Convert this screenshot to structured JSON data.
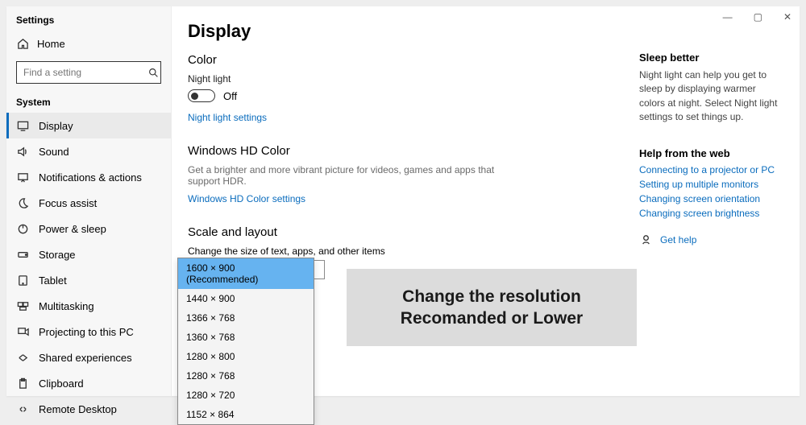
{
  "window": {
    "title": "Settings",
    "controls": {
      "minimize": "—",
      "restore": "▢",
      "close": "✕"
    }
  },
  "sidebar": {
    "home_label": "Home",
    "search_placeholder": "Find a setting",
    "group_label": "System",
    "items": [
      {
        "label": "Display"
      },
      {
        "label": "Sound"
      },
      {
        "label": "Notifications & actions"
      },
      {
        "label": "Focus assist"
      },
      {
        "label": "Power & sleep"
      },
      {
        "label": "Storage"
      },
      {
        "label": "Tablet"
      },
      {
        "label": "Multitasking"
      },
      {
        "label": "Projecting to this PC"
      },
      {
        "label": "Shared experiences"
      },
      {
        "label": "Clipboard"
      },
      {
        "label": "Remote Desktop"
      }
    ]
  },
  "main": {
    "page_title": "Display",
    "color": {
      "heading": "Color",
      "night_light_label": "Night light",
      "night_light_state": "Off",
      "settings_link": "Night light settings"
    },
    "hd": {
      "heading": "Windows HD Color",
      "desc": "Get a brighter and more vibrant picture for videos, games and apps that support HDR.",
      "link": "Windows HD Color settings"
    },
    "scale": {
      "heading": "Scale and layout",
      "label": "Change the size of text, apps, and other items"
    },
    "resolutions": [
      "1600 × 900 (Recommended)",
      "1440 × 900",
      "1366 × 768",
      "1360 × 768",
      "1280 × 800",
      "1280 × 768",
      "1280 × 720",
      "1152 × 864"
    ]
  },
  "right": {
    "sleep_heading": "Sleep better",
    "sleep_body": "Night light can help you get to sleep by displaying warmer colors at night. Select Night light settings to set things up.",
    "help_heading": "Help from the web",
    "links": [
      "Connecting to a projector or PC",
      "Setting up multiple monitors",
      "Changing screen orientation",
      "Changing screen brightness"
    ],
    "get_help": "Get help"
  },
  "overlay_note": "Change the resolution Recomanded or Lower"
}
